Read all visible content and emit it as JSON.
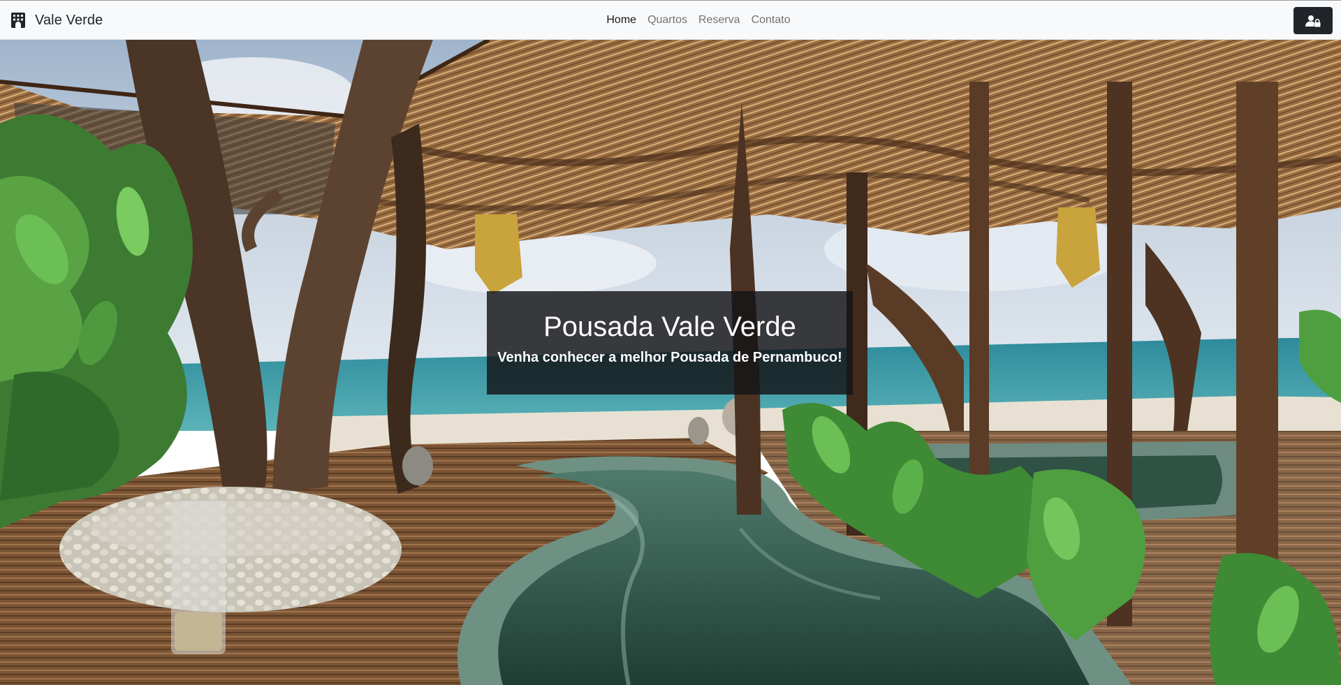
{
  "navbar": {
    "brand": {
      "icon": "hotel-building-icon",
      "text": "Vale Verde"
    },
    "links": [
      {
        "label": "Home",
        "active": true
      },
      {
        "label": "Quartos",
        "active": false
      },
      {
        "label": "Reserva",
        "active": false
      },
      {
        "label": "Contato",
        "active": false
      }
    ],
    "login_button": {
      "icon": "user-lock-icon"
    }
  },
  "hero": {
    "title": "Pousada Vale Verde",
    "subtitle": "Venha conhecer a melhor Pousada de Pernambuco!"
  },
  "colors": {
    "navbar_bg": "#f8f9fa",
    "button_dark": "#212529",
    "caption_bg": "#141416"
  }
}
